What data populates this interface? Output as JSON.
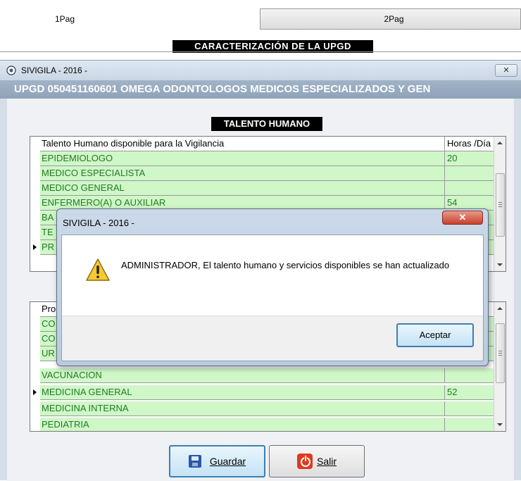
{
  "top": {
    "page1_label": "1Pag",
    "page2_label": "2Pag",
    "banner": "CARACTERIZACIÓN DE LA UPGD"
  },
  "window": {
    "title": "SIVIGILA - 2016 -",
    "close_glyph": "✕",
    "upgd_line": "UPGD 050451160601 OMEGA ODONTOLOGOS MEDICOS ESPECIALIZADOS Y GEN"
  },
  "talento": {
    "section_title": "TALENTO HUMANO",
    "headers": [
      "Talento Humano disponible para la Vigilancia",
      "Horas /Día"
    ],
    "rows": [
      [
        "EPIDEMIOLOGO",
        "20"
      ],
      [
        "MEDICO ESPECIALISTA",
        ""
      ],
      [
        "MEDICO GENERAL",
        ""
      ],
      [
        "ENFERMERO(A) O AUXILIAR",
        "54"
      ],
      [
        "BA",
        ""
      ],
      [
        "TE",
        ""
      ],
      [
        "PR",
        ""
      ]
    ]
  },
  "servicios": {
    "header_partial": "Pro",
    "rows": [
      [
        "CO",
        ""
      ],
      [
        "CO",
        ""
      ],
      [
        "UR",
        ""
      ],
      [
        "VACUNACION",
        ""
      ],
      [
        "MEDICINA GENERAL",
        "52"
      ],
      [
        "MEDICINA INTERNA",
        ""
      ],
      [
        "PEDIATRIA",
        ""
      ]
    ]
  },
  "buttons": {
    "guardar": "Guardar",
    "salir": "Salir"
  },
  "dialog": {
    "title": "SIVIGILA - 2016 -",
    "close_glyph": "✕",
    "message": "ADMINISTRADOR, El talento humano y servicios disponibles se han actualizado",
    "ok_label": "Aceptar"
  },
  "colors": {
    "row_fill": "#cff7c8",
    "row_text": "#237a23",
    "upgd_bar": "#8ea2b9",
    "dialog_close": "#c8412c"
  }
}
